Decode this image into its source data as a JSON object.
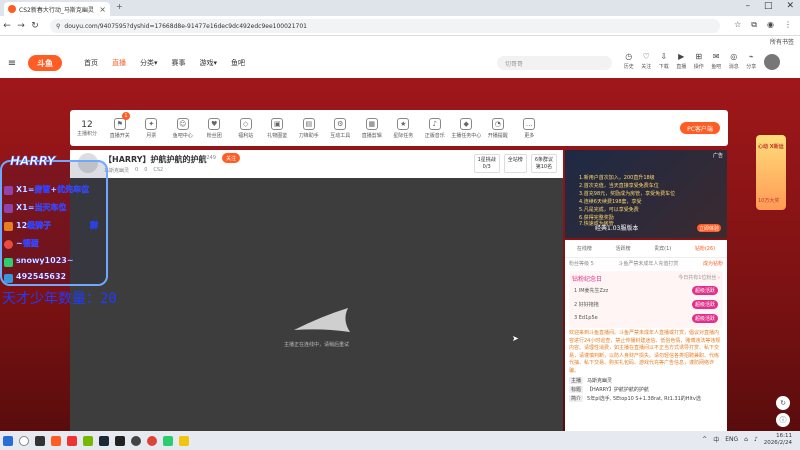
{
  "browser": {
    "tab_title": "CS2新春大行动_马斯克幽灵",
    "new_tab": "+",
    "url": "douyu.com/9407595?dyshid=17668d8e-91477e16dec9dc492edc9ee100021701",
    "all_bookmarks": "所有书签",
    "window_controls": [
      "–",
      "□",
      "✕"
    ]
  },
  "site": {
    "logo_text": "斗鱼",
    "nav": [
      "首页",
      "直播",
      "分类▾",
      "赛事",
      "游戏▾",
      "鱼吧"
    ],
    "search_placeholder": "切哥哥",
    "header_icons": [
      {
        "label": "历史",
        "glyph": "◷"
      },
      {
        "label": "关注",
        "glyph": "♡"
      },
      {
        "label": "下载",
        "glyph": "⇩"
      },
      {
        "label": "直播",
        "glyph": "▶"
      },
      {
        "label": "操作",
        "glyph": "⊞"
      },
      {
        "label": "鱼吧",
        "glyph": "✉"
      },
      {
        "label": "消息",
        "glyph": "◎"
      },
      {
        "label": "分享",
        "glyph": "⌁"
      }
    ]
  },
  "toolbar": {
    "level": "12",
    "level_label": "主播积分",
    "client_button": "PC客户端",
    "items": [
      {
        "label": "直播开关",
        "glyph": "⚑",
        "badge": "1"
      },
      {
        "label": "月票",
        "glyph": "✦"
      },
      {
        "label": "鱼吧中心",
        "glyph": "☺"
      },
      {
        "label": "粉丝团",
        "glyph": "♥"
      },
      {
        "label": "福利站",
        "glyph": "◇"
      },
      {
        "label": "礼物图鉴",
        "glyph": "▣"
      },
      {
        "label": "刀锋助手",
        "glyph": "▤"
      },
      {
        "label": "互动工具",
        "glyph": "⚙"
      },
      {
        "label": "直播剪辑",
        "glyph": "▦"
      },
      {
        "label": "星际任务",
        "glyph": "★"
      },
      {
        "label": "正版音乐",
        "glyph": "♪"
      },
      {
        "label": "主播任务中心",
        "glyph": "◆"
      },
      {
        "label": "开播提醒",
        "glyph": "◔"
      },
      {
        "label": "更多",
        "glyph": "…"
      }
    ]
  },
  "room": {
    "title": "【HARRY】护航护航的护航",
    "id": "48249",
    "follow": "关注",
    "tag": "马斯克幽灵",
    "likes": "0",
    "views": "0",
    "category": "CS2",
    "right_boxes": [
      {
        "l1": "1星挑战",
        "l2": "0/3"
      },
      {
        "l1": "全站榜",
        "l2": ""
      },
      {
        "l1": "6条群议",
        "l2": "第10名"
      }
    ]
  },
  "video": {
    "loading_text": "主播正在连线中，请稍后重试"
  },
  "overlay": {
    "title": "HARRY",
    "lines": [
      "X1=房管+优先车位",
      "X1=当天车位",
      "12级牌子",
      "~银蛋",
      "snowy1023~",
      "492545632"
    ],
    "wechat_word": "群",
    "counter_text": "天才少年数量：20"
  },
  "ad": {
    "tag": "广告",
    "lines": [
      "1.新用户首次加入，200直升18级",
      "2.首次充值，当天直接享受免费车位",
      "3.首充98元，奖励成为房管，享受免费车位",
      "4.连续6天续费198套，享受",
      "5.凡是完成，可以享受免费",
      "6.获得完整奖励",
      "7.快速成为房管"
    ],
    "bottom_text": "经典1.03服版本",
    "button": "立即体验"
  },
  "side_panel": {
    "tabs": [
      "在线榜",
      "活跃榜",
      "贵宾(1)",
      "钻粉(26)"
    ],
    "active_tab": 3,
    "sub_left": "粉丝等级 5",
    "sub_mid": "斗鱼严禁未成年人充值打赏",
    "sub_right": "成为钻粉",
    "card_title": "钻粉纪念日",
    "card_right": "今日共有1位粉丝 ›",
    "ranks": [
      {
        "name": "1 IM姜先生Zzz",
        "pill": "超级活跃"
      },
      {
        "name": "2 好好拖拖",
        "pill": "超级活跃"
      },
      {
        "name": "3 Ed1p5e",
        "pill": "超级活跃"
      }
    ],
    "welcome": "欢迎来到斗鱼直播间。斗鱼严禁未成年人直播或打赏，倡议对直播内容进行24小时巡查，禁止传播封建迷信、低俗色情，赌博违法等违规内容。请理性消费，如主播在直播间以不正当方式诱导打赏、私下交易，请谨慎判断，以防人身财产损失。请勿轻信各类招聘兼职、代练代抽、私下交易、购买礼包码、游戏代充等广告信息，谨防网络诈骗。",
    "info": [
      {
        "k": "主播",
        "v": "马斯克幽灵"
      },
      {
        "k": "标题",
        "v": "【HARRY】护航护航的护航"
      },
      {
        "k": "简介",
        "v": "5年pl选手, 5Etop10 S+1.38rat, Rt1.31的Hltv选"
      }
    ]
  },
  "gift_side": {
    "top": "心动 X新运",
    "bottom": "10万大奖"
  },
  "taskbar": {
    "lang": "ENG",
    "time": "16:11",
    "date": "2026/2/24"
  },
  "colors": {
    "accent": "#ff5d23",
    "pink": "#e0308a",
    "overlay_blue": "#1f3cff"
  }
}
